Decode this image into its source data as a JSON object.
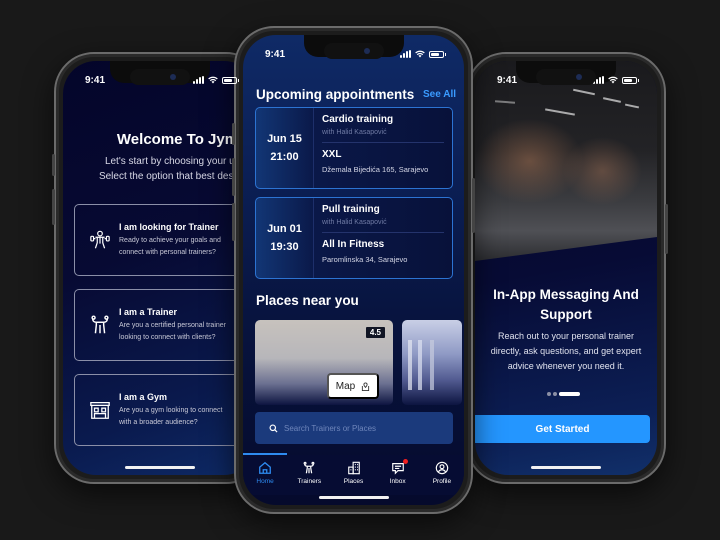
{
  "status_time": "9:41",
  "left_phone": {
    "title": "Welcome To Jym!",
    "subtitle_line1": "Let's start by choosing your user type.",
    "subtitle_line2": "Select the option that best describes you",
    "roles": [
      {
        "icon": "trainee-icon",
        "title": "I am looking for Trainer",
        "desc_line1": "Ready to achieve your goals and",
        "desc_line2": "connect with personal trainers?"
      },
      {
        "icon": "trainer-icon",
        "title": "I am a Trainer",
        "desc_line1": "Are you a certified personal trainer",
        "desc_line2": "looking to connect with clients?"
      },
      {
        "icon": "gym-icon",
        "title": "I am a Gym",
        "desc_line1": "Are you a gym looking to connect",
        "desc_line2": "with a broader audience?"
      }
    ]
  },
  "center_phone": {
    "appointments_title": "Upcoming appointments",
    "see_all": "See All",
    "appointments": [
      {
        "date": "Jun 15",
        "time": "21:00",
        "activity": "Cardio training",
        "trainer": "with Halid Kasapović",
        "place": "XXL",
        "address": "Džemala Bijedića 165, Sarajevo"
      },
      {
        "date": "Jun 01",
        "time": "19:30",
        "activity": "Pull training",
        "trainer": "with Halid Kasapović",
        "place": "All In Fitness",
        "address": "Paromlinska 34, Sarajevo"
      }
    ],
    "places_title": "Places near you",
    "places": [
      {
        "rating": "4.5",
        "map_label": "Map"
      },
      {
        "rating": ""
      }
    ],
    "search_placeholder": "Search Trainers or Places",
    "tabs": [
      {
        "label": "Home",
        "icon": "home-icon",
        "active": true
      },
      {
        "label": "Trainers",
        "icon": "trainers-icon",
        "active": false
      },
      {
        "label": "Places",
        "icon": "buildings-icon",
        "active": false
      },
      {
        "label": "Inbox",
        "icon": "inbox-icon",
        "active": false,
        "badge": true
      },
      {
        "label": "Profile",
        "icon": "profile-icon",
        "active": false
      }
    ]
  },
  "right_phone": {
    "title_line1": "In-App Messaging And",
    "title_line2": "Support",
    "desc_line1": "Reach out to your personal trainer",
    "desc_line2": "directly, ask questions, and get expert",
    "desc_line3": "advice whenever you need it.",
    "pagination": {
      "total": 3,
      "current": 3
    },
    "cta_label": "Get Started"
  },
  "colors": {
    "accent": "#2496ff",
    "link": "#3a9bff",
    "card_border": "#2c73d2",
    "badge": "#f01f1f",
    "background": "#191919"
  }
}
